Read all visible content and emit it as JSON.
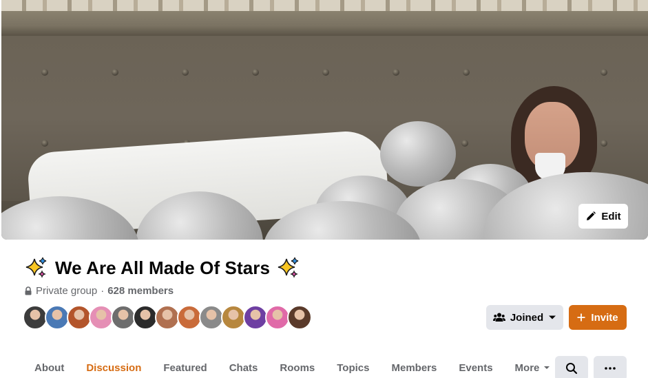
{
  "cover": {
    "edit_label": "Edit"
  },
  "group": {
    "title": "We Are All Made Of Stars",
    "privacy": "Private group",
    "separator": "·",
    "members": "628 members"
  },
  "member_avatars": [
    {
      "color": "#3c3c3c"
    },
    {
      "color": "#4a79b5"
    },
    {
      "color": "#b3552b"
    },
    {
      "color": "#e58fb5"
    },
    {
      "color": "#6d6d6d"
    },
    {
      "color": "#2b2b2b"
    },
    {
      "color": "#b07050"
    },
    {
      "color": "#c96b3a"
    },
    {
      "color": "#8a8a8a"
    },
    {
      "color": "#b7873e"
    },
    {
      "color": "#6e3fa2"
    },
    {
      "color": "#e06aa8"
    },
    {
      "color": "#5a3a2a"
    }
  ],
  "actions": {
    "joined_label": "Joined",
    "invite_label": "Invite"
  },
  "tabs": [
    {
      "label": "About"
    },
    {
      "label": "Discussion",
      "active": true
    },
    {
      "label": "Featured"
    },
    {
      "label": "Chats"
    },
    {
      "label": "Rooms"
    },
    {
      "label": "Topics"
    },
    {
      "label": "Members"
    },
    {
      "label": "Events"
    },
    {
      "label": "More"
    }
  ],
  "colors": {
    "accent": "#d66c13",
    "secondary_button": "#e4e6eb",
    "muted_text": "#65676b"
  },
  "icons": [
    "pencil-icon",
    "sparkle-emoji-icon",
    "lock-icon",
    "people-icon",
    "caret-down-icon",
    "plus-icon",
    "search-icon",
    "ellipsis-icon"
  ]
}
